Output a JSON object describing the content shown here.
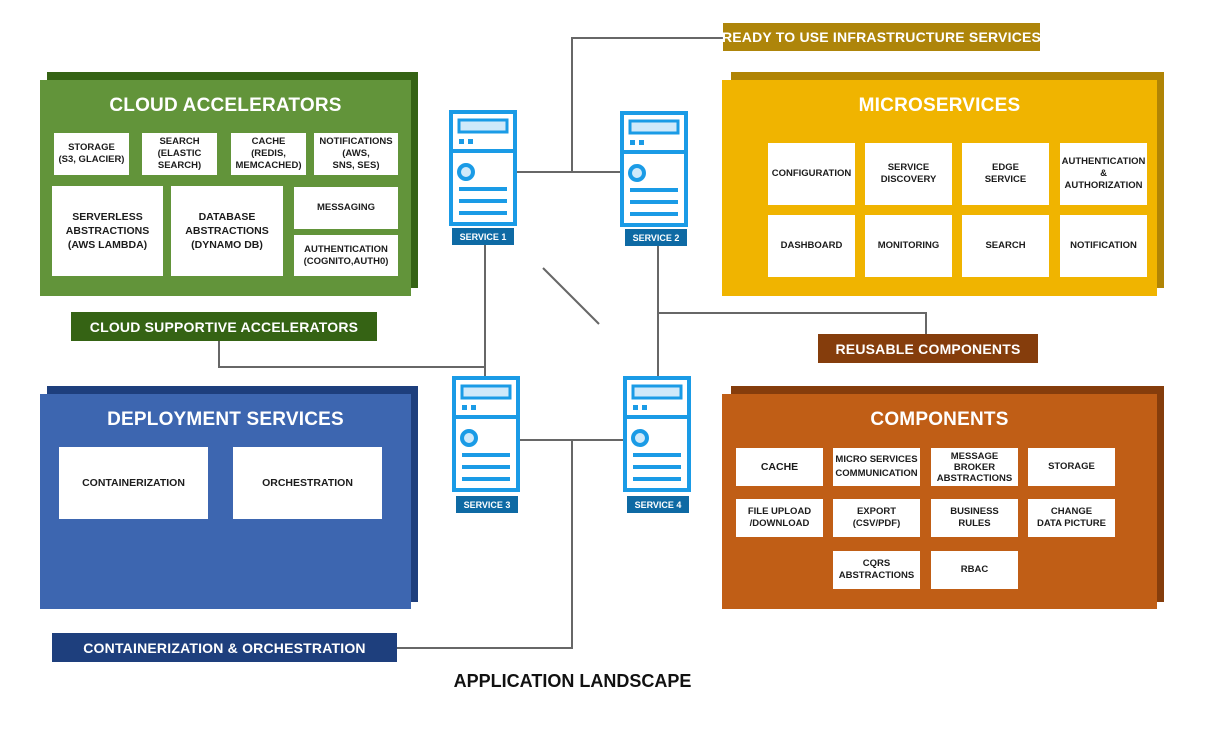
{
  "title": "APPLICATION LANDSCAPE",
  "colors": {
    "cloud": "#62943a",
    "cloud_dark": "#356314",
    "micro": "#f0b400",
    "micro_dark": "#b08405",
    "components": "#c05e16",
    "components_dark": "#853d0c",
    "deploy": "#3d66b0",
    "deploy_dark": "#1e3f7d",
    "server_blue": "#1a9be6",
    "service_label": "#0e6aa4",
    "connector": "#676767"
  },
  "tags": {
    "infrastructure": "READY TO USE INFRASTRUCTURE SERVICES",
    "cloud_supportive": "CLOUD SUPPORTIVE ACCELERATORS",
    "reusable": "REUSABLE COMPONENTS",
    "containerization": "CONTAINERIZATION & ORCHESTRATION"
  },
  "cloud_accelerators": {
    "title": "CLOUD ACCELERATORS",
    "items": [
      "STORAGE\n(S3, GLACIER)",
      "SEARCH\n(ELASTIC\nSEARCH)",
      "CACHE\n(REDIS,\nMEMCACHED)",
      "NOTIFICATIONS\n(AWS,\nSNS, SES)",
      "SERVERLESS\nABSTRACTIONS\n(AWS LAMBDA)",
      "DATABASE\nABSTRACTIONS\n(DYNAMO DB)",
      "MESSAGING",
      "AUTHENTICATION\n(COGNITO,AUTH0)"
    ]
  },
  "microservices": {
    "title": "MICROSERVICES",
    "items": [
      "CONFIGURATION",
      "SERVICE\nDISCOVERY",
      "EDGE\nSERVICE",
      "AUTHENTICATION\n& AUTHORIZATION",
      "DASHBOARD",
      "MONITORING",
      "SEARCH",
      "NOTIFICATION"
    ]
  },
  "deployment_services": {
    "title": "DEPLOYMENT SERVICES",
    "items": [
      "CONTAINERIZATION",
      "ORCHESTRATION"
    ]
  },
  "components": {
    "title": "COMPONENTS",
    "items": [
      "CACHE",
      "MICRO SERVICES\nCOMMUNICATION",
      "MESSAGE\nBROKER\nABSTRACTIONS",
      "STORAGE",
      "FILE UPLOAD\n/DOWNLOAD",
      "EXPORT\n(CSV/PDF)",
      "BUSINESS\nRULES",
      "CHANGE\nDATA PICTURE",
      "CQRS\nABSTRACTIONS",
      "RBAC"
    ]
  },
  "services": [
    "SERVICE 1",
    "SERVICE 2",
    "SERVICE 3",
    "SERVICE 4"
  ]
}
